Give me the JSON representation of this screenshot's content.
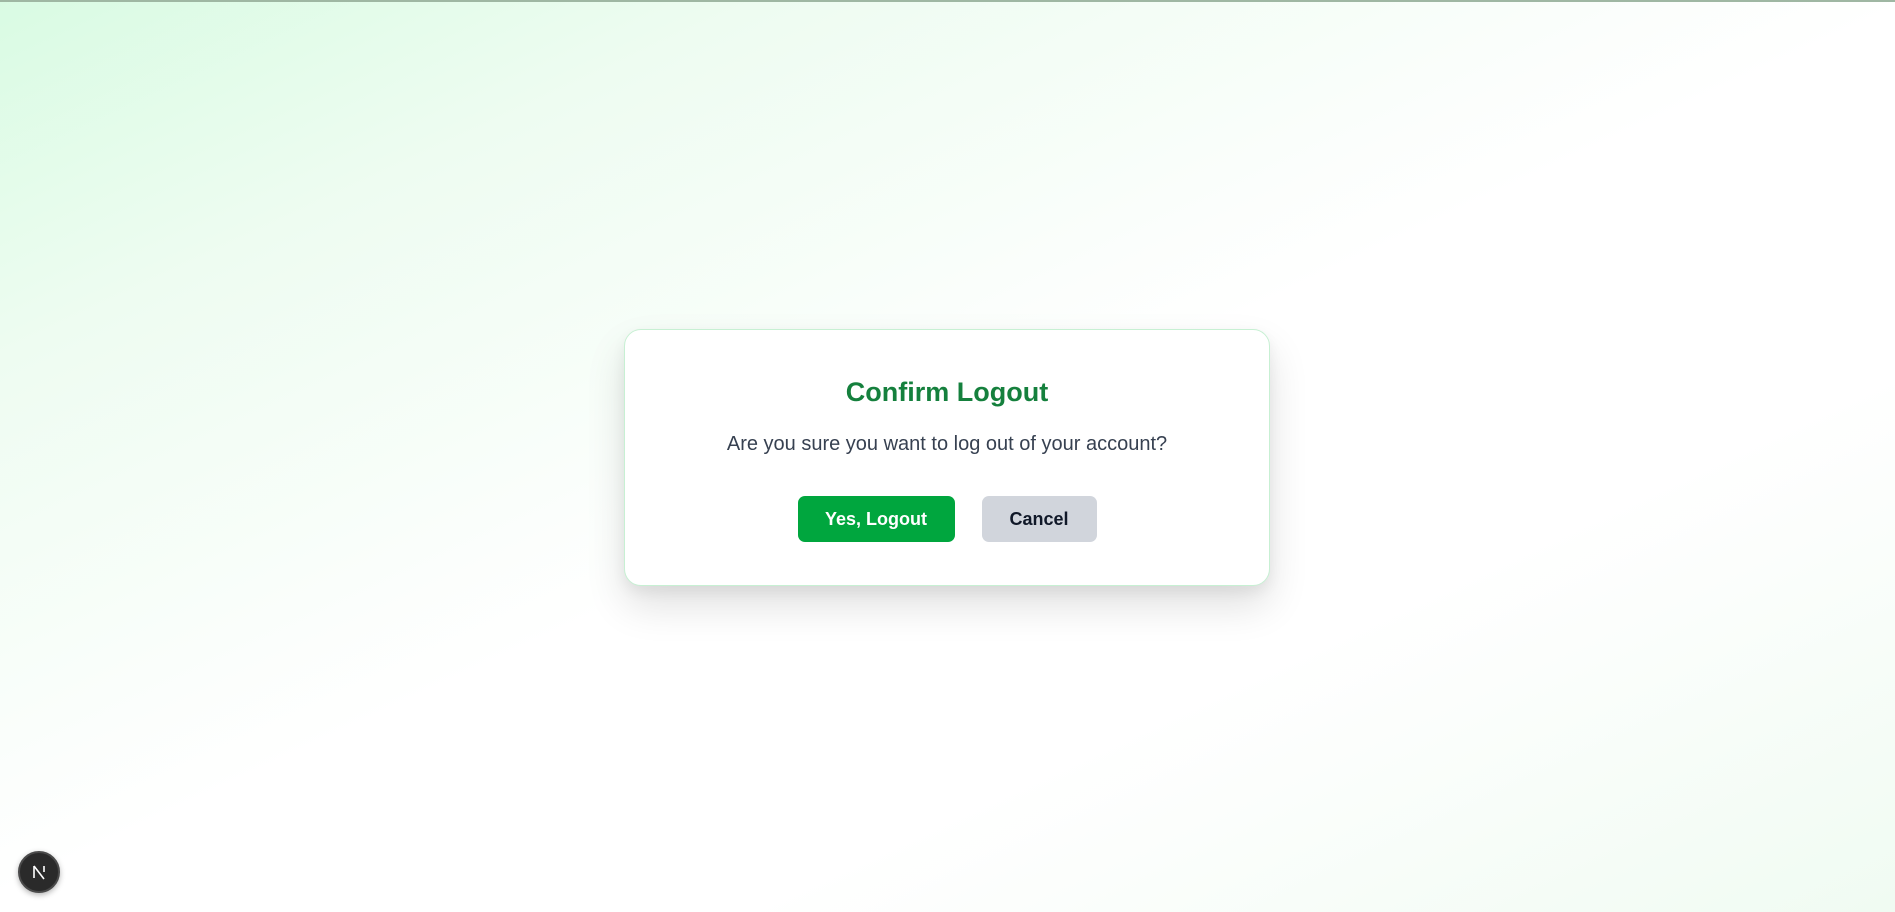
{
  "dialog": {
    "title": "Confirm Logout",
    "message": "Are you sure you want to log out of your account?",
    "confirm_label": "Yes, Logout",
    "cancel_label": "Cancel"
  },
  "dev_indicator": {
    "icon": "nextjs-logo-icon",
    "letter": "N"
  },
  "colors": {
    "title": "#15803d",
    "confirm_bg": "#00a63e",
    "cancel_bg": "#d1d5dc",
    "dialog_border": "#c7f0d3",
    "background_tint": "#d9fbe3"
  }
}
